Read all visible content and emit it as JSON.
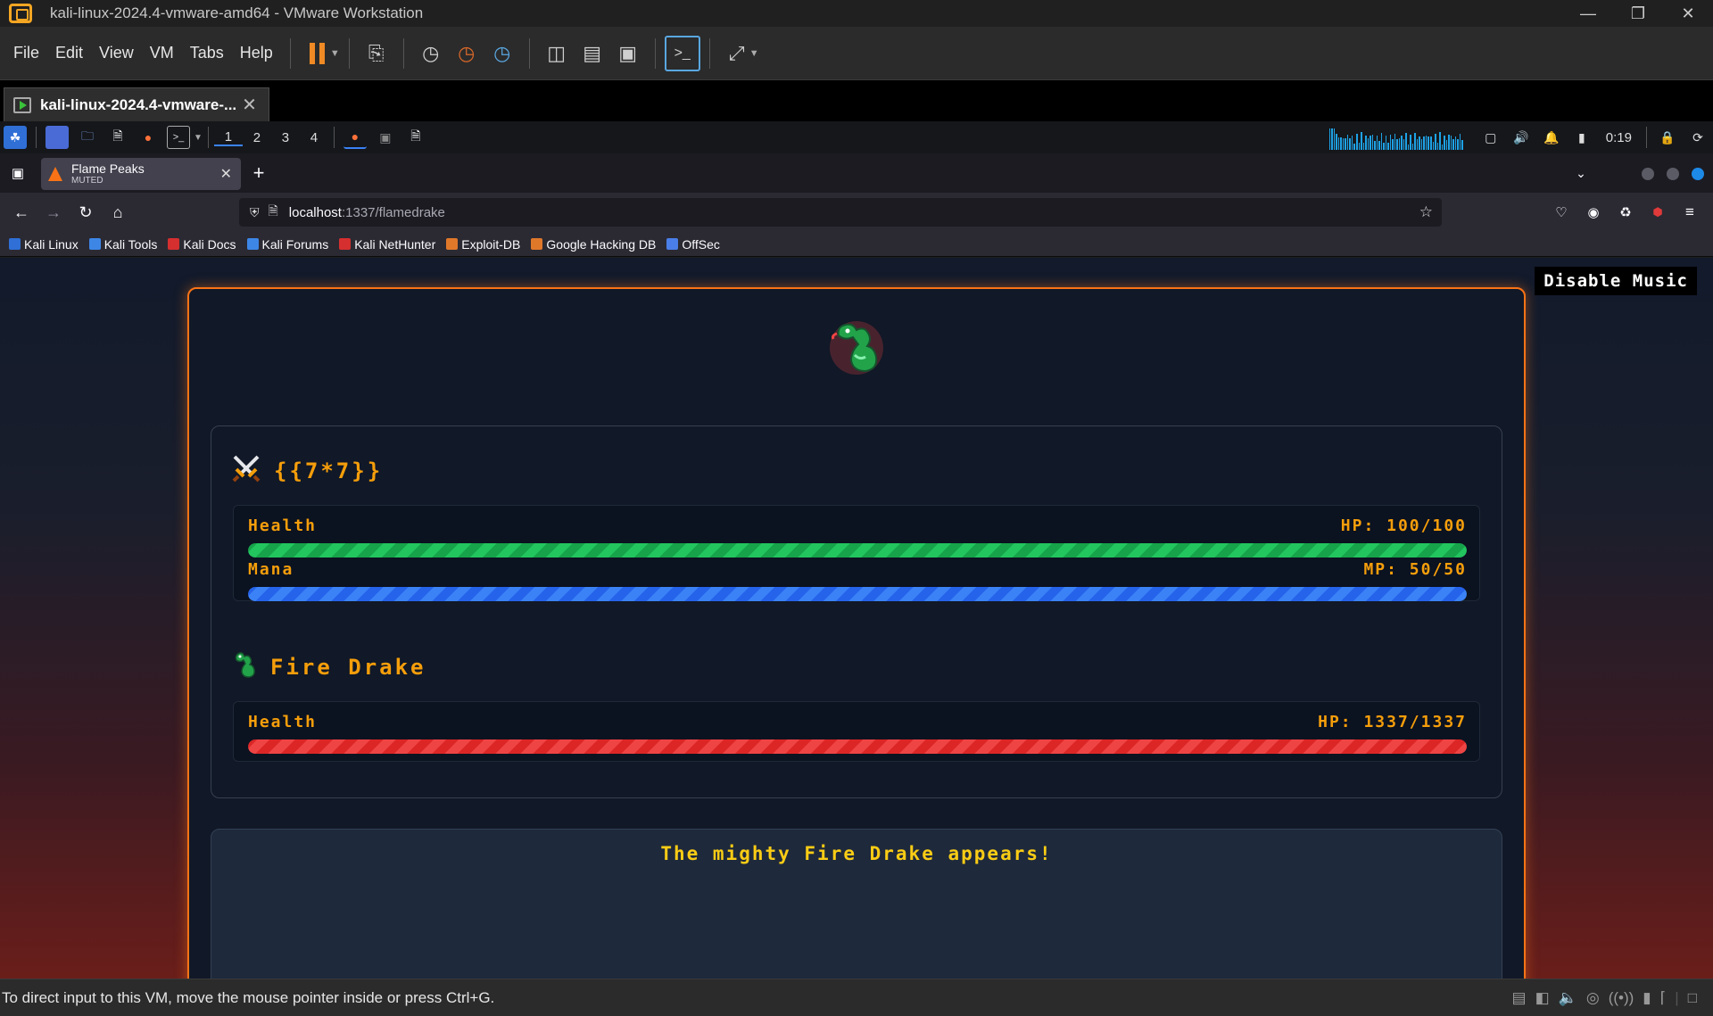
{
  "vmware": {
    "title": "kali-linux-2024.4-vmware-amd64 - VMware Workstation",
    "menu": [
      "File",
      "Edit",
      "View",
      "VM",
      "Tabs",
      "Help"
    ],
    "vm_tab_label": "kali-linux-2024.4-vmware-...",
    "status_text": "To direct input to this VM, move the mouse pointer inside or press Ctrl+G."
  },
  "kali_panel": {
    "workspaces": [
      "1",
      "2",
      "3",
      "4"
    ],
    "clock": "0:19"
  },
  "firefox": {
    "tab_title": "Flame Peaks",
    "tab_subtitle": "MUTED",
    "url_host": "localhost",
    "url_path": ":1337/flamedrake",
    "bookmarks": [
      {
        "label": "Kali Linux",
        "color": "#2f6fd6"
      },
      {
        "label": "Kali Tools",
        "color": "#3d86e6"
      },
      {
        "label": "Kali Docs",
        "color": "#d62f2f"
      },
      {
        "label": "Kali Forums",
        "color": "#3d86e6"
      },
      {
        "label": "Kali NetHunter",
        "color": "#d62f2f"
      },
      {
        "label": "Exploit-DB",
        "color": "#e0782a"
      },
      {
        "label": "Google Hacking DB",
        "color": "#e0782a"
      },
      {
        "label": "OffSec",
        "color": "#4a7ee8"
      }
    ]
  },
  "game": {
    "music_button": "Disable Music",
    "player": {
      "name": "{{7*7}}",
      "health_label": "Health",
      "health_value": "HP: 100/100",
      "health_fraction": 1.0,
      "mana_label": "Mana",
      "mana_value": "MP: 50/50",
      "mana_fraction": 1.0
    },
    "enemy": {
      "name": "Fire Drake",
      "health_label": "Health",
      "health_value": "HP: 1337/1337",
      "health_fraction": 1.0
    },
    "log_message": "The mighty Fire Drake appears!"
  },
  "colors": {
    "accent": "#f97316",
    "text_gold": "#f59e0b",
    "health": "#22c55e",
    "mana": "#3b82f6",
    "enemy_health": "#ef4444"
  }
}
